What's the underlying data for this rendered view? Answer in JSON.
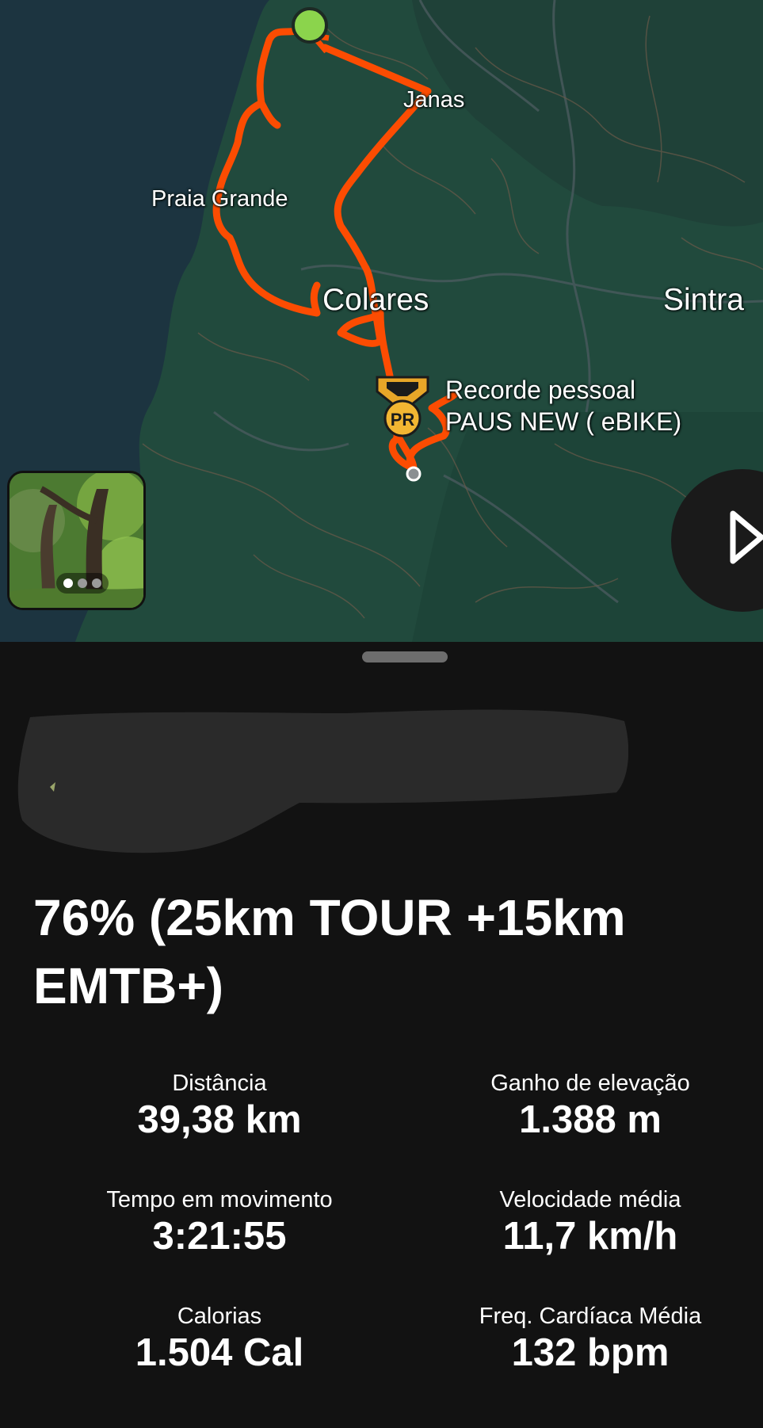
{
  "map": {
    "places": {
      "janas": "Janas",
      "praia_grande": "Praia Grande",
      "colares": "Colares",
      "sintra": "Sintra"
    },
    "pr_badge_text": "PR",
    "pr_line1": "Recorde pessoal",
    "pr_line2": "PAUS NEW ( eBIKE)",
    "route_color": "#FC4C02",
    "start_marker_color": "#8BD44C",
    "photo_count": 3,
    "photo_active_index": 0
  },
  "activity": {
    "title": "76% (25km TOUR +15km EMTB+)"
  },
  "stats": {
    "distance": {
      "label": "Distância",
      "value": "39,38 km"
    },
    "elevation": {
      "label": "Ganho de elevação",
      "value": "1.388 m"
    },
    "moving_time": {
      "label": "Tempo em movimento",
      "value": "3:21:55"
    },
    "avg_speed": {
      "label": "Velocidade média",
      "value": "11,7 km/h"
    },
    "calories": {
      "label": "Calorias",
      "value": "1.504 Cal"
    },
    "avg_hr": {
      "label": "Freq. Cardíaca Média",
      "value": "132 bpm"
    }
  },
  "colors": {
    "background": "#121212",
    "sea": "#1c3440",
    "land": "#214a3d",
    "accent": "#FC4C02"
  }
}
